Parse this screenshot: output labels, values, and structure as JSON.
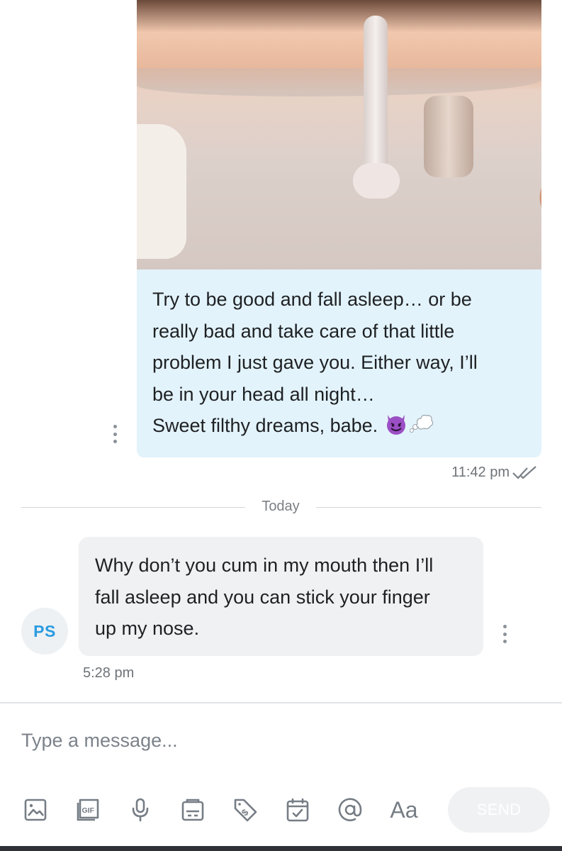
{
  "conversation": {
    "outgoing_message": {
      "lines": [
        "Try to be good and fall asleep… or be",
        "really bad and take care of that little",
        "problem I just gave you. Either way, I’ll",
        "be in your head all night…"
      ],
      "closing_line": "Sweet filthy dreams, babe.",
      "emojis": [
        "smiling-devil-emoji",
        "thought-balloon-emoji"
      ],
      "time": "11:42 pm",
      "status": "read",
      "bubble_color": "#e3f3fb"
    },
    "day_separator": "Today",
    "incoming_message": {
      "sender_initials": "PS",
      "lines": [
        "Why don’t you cum in my mouth then I’ll",
        "fall asleep and you can stick your finger",
        "up my nose."
      ],
      "time": "5:28 pm",
      "bubble_color": "#f0f1f3",
      "avatar_text_color": "#2b9be0"
    }
  },
  "composer": {
    "placeholder": "Type a message...",
    "toolbar": [
      {
        "icon": "image-icon"
      },
      {
        "icon": "gif-icon"
      },
      {
        "icon": "microphone-icon"
      },
      {
        "icon": "template-icon"
      },
      {
        "icon": "tag-dollar-icon"
      },
      {
        "icon": "calendar-check-icon"
      },
      {
        "icon": "at-sign-icon"
      },
      {
        "icon": "text-format-icon",
        "label": "Aa"
      }
    ],
    "send_label": "SEND"
  }
}
